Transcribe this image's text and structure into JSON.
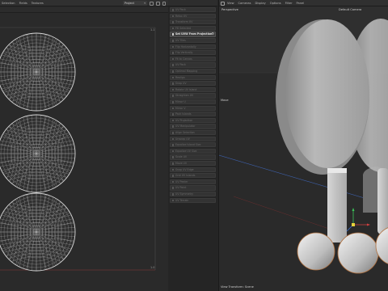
{
  "uv_editor": {
    "menu": [
      "Selection",
      "Fields",
      "Textures"
    ],
    "projection_dropdown": "Project",
    "scale_marks": {
      "top": "1.1",
      "bottom": "1.0"
    }
  },
  "command_list": {
    "items": [
      {
        "label": "UV Pack"
      },
      {
        "label": "Relax UV"
      },
      {
        "label": "Transform UV"
      },
      {
        "label": "Fill Selected"
      },
      {
        "label": "Set UVW From Projection",
        "active": true
      },
      {
        "label": "UV Tiles"
      },
      {
        "label": "Flip Horizontally"
      },
      {
        "label": "Flip Vertically"
      },
      {
        "label": "Fit to Canvas"
      },
      {
        "label": "UV Pack"
      },
      {
        "label": "Optimal Mapping"
      },
      {
        "label": "Realign"
      },
      {
        "label": "Snap UV"
      },
      {
        "label": "Rotate UV Island"
      },
      {
        "label": "Straighten UV"
      },
      {
        "label": "Mirror U"
      },
      {
        "label": "Mirror V"
      },
      {
        "label": "Pack Islands"
      },
      {
        "label": "UV Projection"
      },
      {
        "label": "UV Manipulator"
      },
      {
        "label": "Align Selection"
      },
      {
        "label": "Unwrap UV"
      },
      {
        "label": "Equalize Island Size"
      },
      {
        "label": "Equalize UV Size"
      },
      {
        "label": "Scale UV"
      },
      {
        "label": "Move UV"
      },
      {
        "label": "Snap UV Edge"
      },
      {
        "label": "Grid UV Islands"
      },
      {
        "label": "UV Peeler"
      },
      {
        "label": "UV Paint"
      },
      {
        "label": "UV Symmetry"
      },
      {
        "label": "UV Terrain"
      }
    ]
  },
  "viewport": {
    "menu": [
      "View",
      "Cameras",
      "Display",
      "Options",
      "Filter",
      "Panel"
    ],
    "perspective_label": "Perspective",
    "camera_label": "Default Camera",
    "move_label": "Move",
    "footer_label": "View Transform: Scene"
  }
}
